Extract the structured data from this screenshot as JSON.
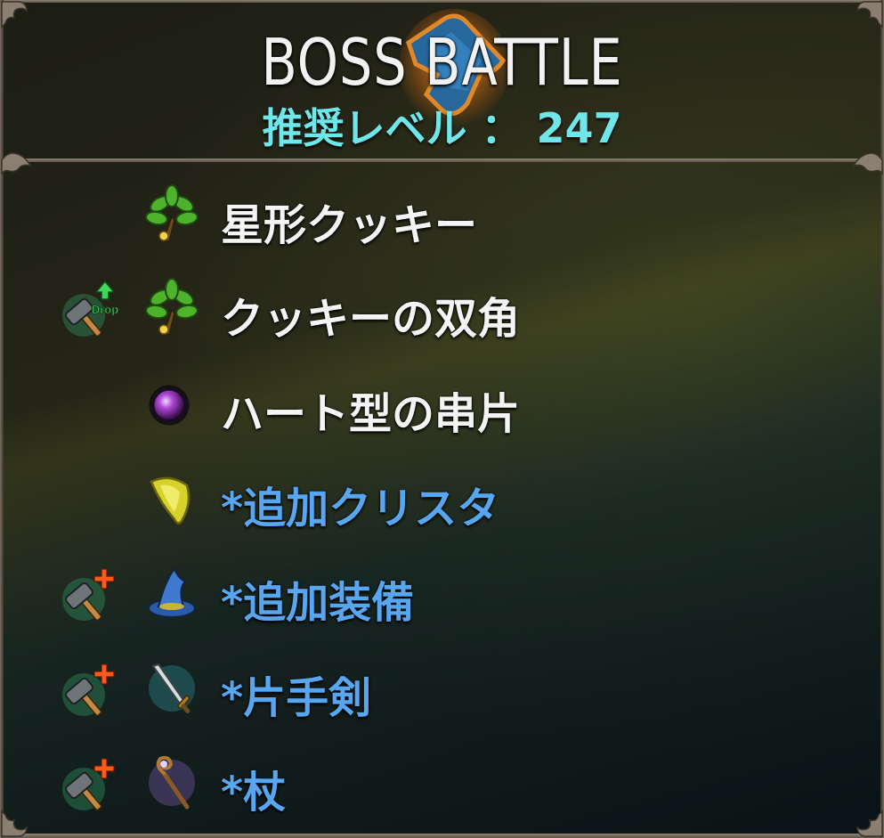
{
  "header": {
    "title": "BOSS BATTLE",
    "recommended_level": "推奨レベル ： 247"
  },
  "drops": [
    {
      "label": "星形クッキー",
      "icon": "leaf-bundle-icon",
      "badge": null,
      "color": "#f4f4f4"
    },
    {
      "label": "クッキーの双角",
      "icon": "leaf-bundle-icon",
      "badge": "hammer-drop-up-icon",
      "color": "#f4f4f4"
    },
    {
      "label": "ハート型の串片",
      "icon": "purple-orb-icon",
      "badge": null,
      "color": "#f4f4f4"
    },
    {
      "label": "*追加クリスタ",
      "icon": "crystal-icon",
      "badge": null,
      "color": "#58a6f0"
    },
    {
      "label": "*追加装備",
      "icon": "wizard-hat-icon",
      "badge": "hammer-plus-icon",
      "color": "#58a6f0"
    },
    {
      "label": "*片手剣",
      "icon": "sword-icon",
      "badge": "hammer-plus-icon",
      "color": "#58a6f0"
    },
    {
      "label": "*杖",
      "icon": "staff-icon",
      "badge": "hammer-plus-icon",
      "color": "#58a6f0"
    }
  ],
  "badge_text": "Drop",
  "colors": {
    "title": "#f2f2f2",
    "level": "#6ee6ea",
    "item_white": "#f4f4f4",
    "item_blue": "#58a6f0",
    "badge_green": "#3fd85a",
    "badge_plus": "#ff5a1e"
  }
}
